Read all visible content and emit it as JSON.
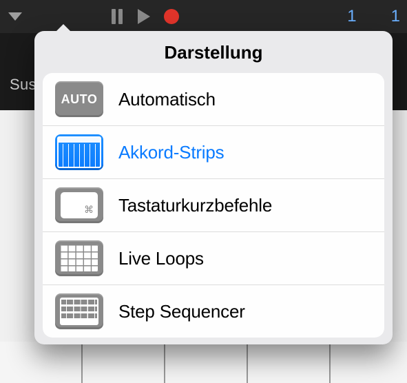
{
  "toolbar": {
    "sust_label": "Sust",
    "counter_left": "1",
    "counter_right": "1"
  },
  "popover": {
    "title": "Darstellung",
    "items": [
      {
        "id": "auto",
        "label": "Automatisch",
        "icon": "auto-icon",
        "auto_text": "AUTO",
        "selected": false
      },
      {
        "id": "chord-strips",
        "label": "Akkord-Strips",
        "icon": "chord-strips-icon",
        "selected": true
      },
      {
        "id": "shortcuts",
        "label": "Tastaturkurzbefehle",
        "icon": "keyboard-shortcut-icon",
        "selected": false
      },
      {
        "id": "live-loops",
        "label": "Live Loops",
        "icon": "grid-icon",
        "selected": false
      },
      {
        "id": "step-seq",
        "label": "Step Sequencer",
        "icon": "step-sequencer-icon",
        "selected": false
      }
    ]
  }
}
